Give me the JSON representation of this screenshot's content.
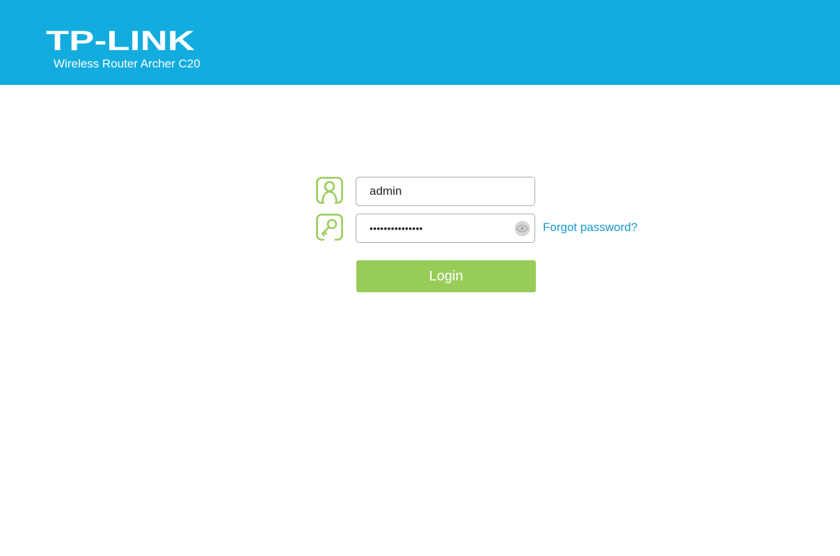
{
  "header": {
    "logo_text": "TP-LINK",
    "subtitle": "Wireless Router Archer C20",
    "background_color": "#12acdf"
  },
  "login": {
    "username_icon": "user-icon",
    "password_icon": "key-icon",
    "username_value": "admin",
    "password_masked": "•••••••••••••••",
    "show_password_icon": "eye-icon",
    "forgot_password_label": "Forgot password?",
    "login_button_label": "Login",
    "accent_color": "#98cc58",
    "link_color": "#1598c9"
  }
}
